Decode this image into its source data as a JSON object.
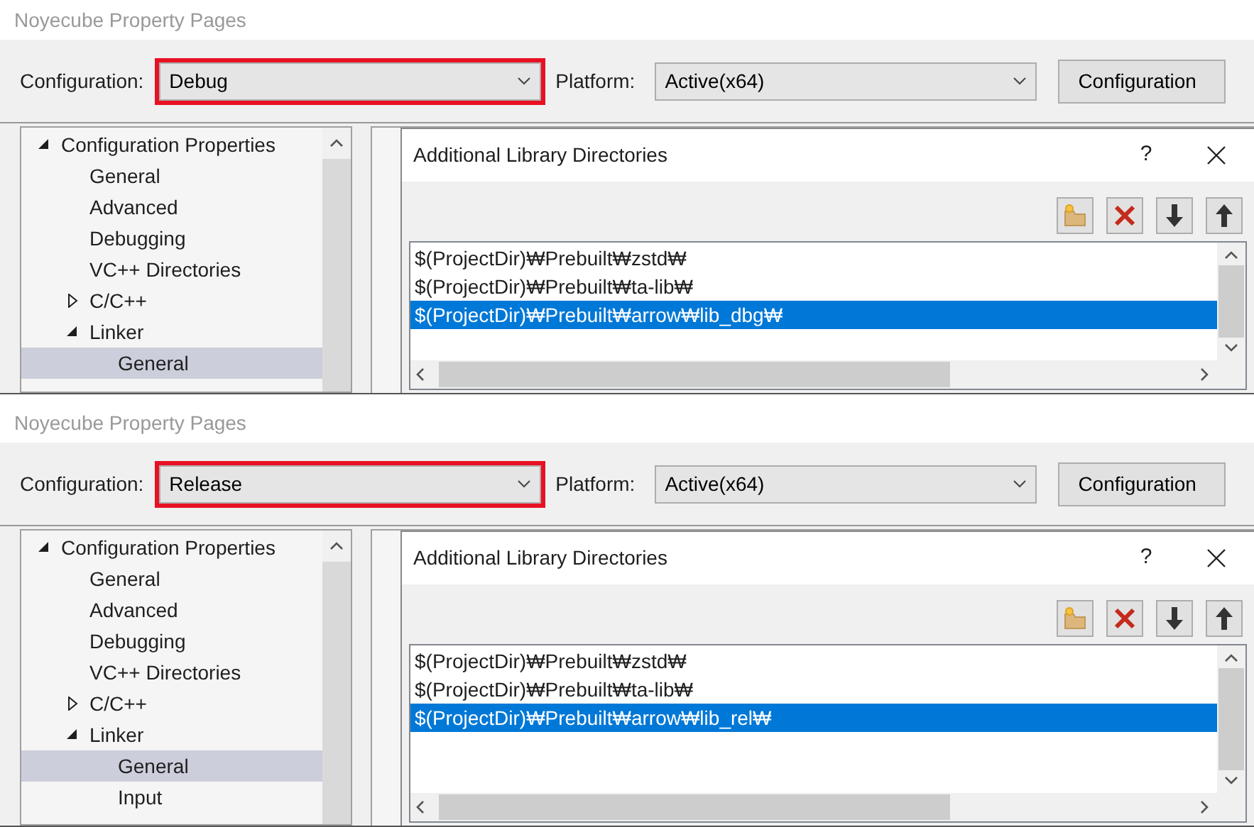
{
  "panels": [
    {
      "window": {
        "title": "Noyecube Property Pages"
      },
      "configuration": {
        "label": "Configuration:",
        "value": "Debug",
        "highlighted": true
      },
      "platform": {
        "label": "Platform:",
        "value": "Active(x64)",
        "highlighted": false
      },
      "configuration_manager_button": "Configuration",
      "tree": [
        {
          "label": "Configuration Properties",
          "expanded": true,
          "selected": false,
          "children": [
            {
              "label": "General",
              "selected": false
            },
            {
              "label": "Advanced",
              "selected": false
            },
            {
              "label": "Debugging",
              "selected": false
            },
            {
              "label": "VC++ Directories",
              "selected": false
            },
            {
              "label": "C/C++",
              "expanded": false,
              "selected": false
            },
            {
              "label": "Linker",
              "expanded": true,
              "selected": false,
              "children": [
                {
                  "label": "General",
                  "selected": true
                }
              ]
            }
          ]
        }
      ],
      "dialog": {
        "title": "Additional Library Directories",
        "help": "?",
        "directories": [
          {
            "path": "$(ProjectDir)₩Prebuilt₩zstd₩",
            "selected": false
          },
          {
            "path": "$(ProjectDir)₩Prebuilt₩ta-lib₩",
            "selected": false
          },
          {
            "path": "$(ProjectDir)₩Prebuilt₩arrow₩lib_dbg₩",
            "selected": true
          }
        ]
      }
    },
    {
      "window": {
        "title": "Noyecube Property Pages"
      },
      "configuration": {
        "label": "Configuration:",
        "value": "Release",
        "highlighted": true
      },
      "platform": {
        "label": "Platform:",
        "value": "Active(x64)",
        "highlighted": false
      },
      "configuration_manager_button": "Configuration",
      "tree": [
        {
          "label": "Configuration Properties",
          "expanded": true,
          "selected": false,
          "children": [
            {
              "label": "General",
              "selected": false
            },
            {
              "label": "Advanced",
              "selected": false
            },
            {
              "label": "Debugging",
              "selected": false
            },
            {
              "label": "VC++ Directories",
              "selected": false
            },
            {
              "label": "C/C++",
              "expanded": false,
              "selected": false
            },
            {
              "label": "Linker",
              "expanded": true,
              "selected": false,
              "children": [
                {
                  "label": "General",
                  "selected": true
                },
                {
                  "label": "Input",
                  "selected": false
                }
              ]
            }
          ]
        }
      ],
      "dialog": {
        "title": "Additional Library Directories",
        "help": "?",
        "directories": [
          {
            "path": "$(ProjectDir)₩Prebuilt₩zstd₩",
            "selected": false
          },
          {
            "path": "$(ProjectDir)₩Prebuilt₩ta-lib₩",
            "selected": false
          },
          {
            "path": "$(ProjectDir)₩Prebuilt₩arrow₩lib_rel₩",
            "selected": true
          }
        ]
      }
    }
  ]
}
